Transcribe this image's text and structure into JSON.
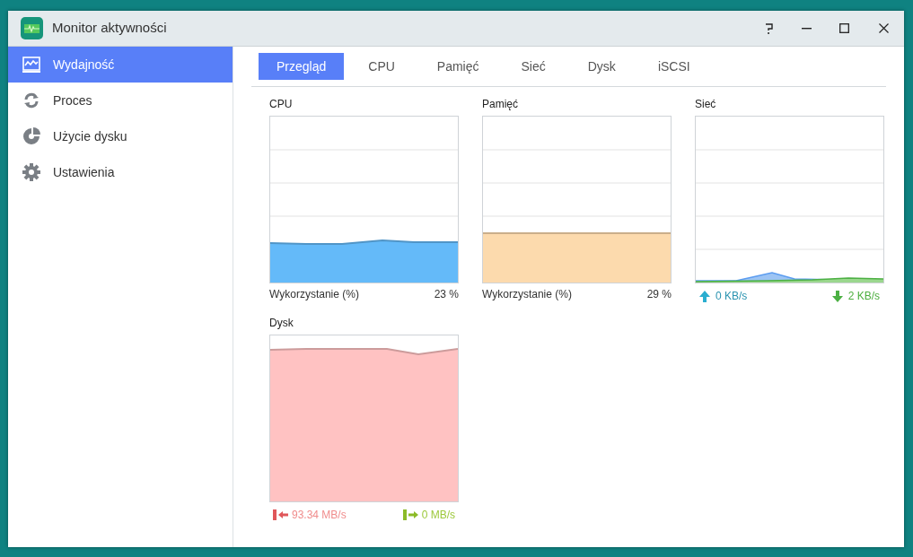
{
  "window": {
    "title": "Monitor aktywności"
  },
  "sidebar": {
    "items": [
      {
        "label": "Wydajność",
        "kind": "performance",
        "selected": true
      },
      {
        "label": "Proces",
        "kind": "process",
        "selected": false
      },
      {
        "label": "Użycie dysku",
        "kind": "disk",
        "selected": false
      },
      {
        "label": "Ustawienia",
        "kind": "settings",
        "selected": false
      }
    ]
  },
  "tabs": [
    {
      "label": "Przegląd",
      "selected": true
    },
    {
      "label": "CPU",
      "selected": false
    },
    {
      "label": "Pamięć",
      "selected": false
    },
    {
      "label": "Sieć",
      "selected": false
    },
    {
      "label": "Dysk",
      "selected": false
    },
    {
      "label": "iSCSI",
      "selected": false
    }
  ],
  "charts": [
    {
      "kind": "usage",
      "title": "CPU",
      "color": "#64baf9",
      "footer_label": "Wykorzystanie (%)",
      "reading": "23 %"
    },
    {
      "kind": "usage",
      "title": "Pamięć",
      "color": "#fcdaad",
      "footer_label": "Wykorzystanie (%)",
      "reading": "29 %"
    },
    {
      "kind": "network",
      "title": "Sieć",
      "upload": "0 KB/s",
      "download": "2 KB/s"
    },
    {
      "kind": "disk",
      "title": "Dysk",
      "color": "#ffc2c2",
      "read": "93.34 MB/s",
      "write": "0 MB/s"
    }
  ]
}
